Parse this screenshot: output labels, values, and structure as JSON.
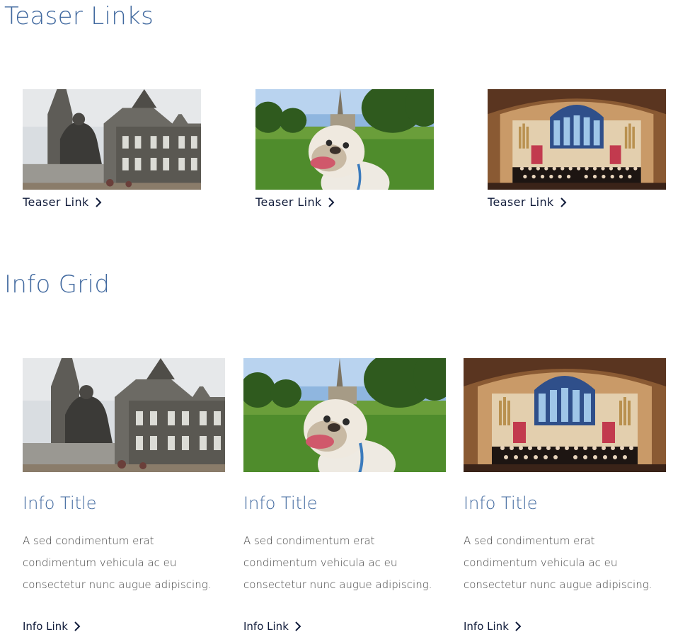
{
  "teaser_section": {
    "title": "Teaser Links",
    "cards": [
      {
        "image": "university-building-statue-photo",
        "link_label": "Teaser Link",
        "icon": "chevron-right-icon"
      },
      {
        "image": "bulldog-on-lawn-photo",
        "link_label": "Teaser Link",
        "icon": "chevron-right-icon"
      },
      {
        "image": "chapel-choir-photo",
        "link_label": "Teaser Link",
        "icon": "chevron-right-icon"
      }
    ]
  },
  "info_section": {
    "title": "Info Grid",
    "cards": [
      {
        "image": "university-building-statue-photo",
        "title": "Info Title",
        "body": "A sed condimentum erat condimentum vehicula ac eu consectetur nunc augue adipiscing.",
        "link_label": "Info Link",
        "icon": "chevron-right-icon"
      },
      {
        "image": "bulldog-on-lawn-photo",
        "title": "Info Title",
        "body": "A sed condimentum erat condimentum vehicula ac eu consectetur nunc augue adipiscing.",
        "link_label": "Info Link",
        "icon": "chevron-right-icon"
      },
      {
        "image": "chapel-choir-photo",
        "title": "Info Title",
        "body": "A sed condimentum erat condimentum vehicula ac eu consectetur nunc augue adipiscing.",
        "link_label": "Info Link",
        "icon": "chevron-right-icon"
      }
    ]
  },
  "colors": {
    "heading": "#41699f",
    "link": "#111c3b",
    "body_text": "#444444"
  }
}
